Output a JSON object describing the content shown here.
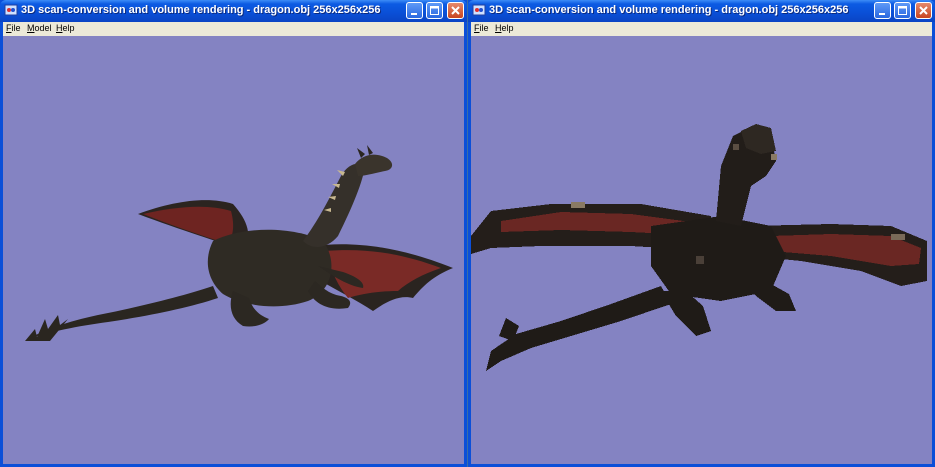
{
  "windows": [
    {
      "id": "left",
      "title": "3D scan-conversion and volume rendering - dragon.obj 256x256x256",
      "menu": [
        {
          "first": "F",
          "rest": "ile"
        },
        {
          "first": "M",
          "rest": "odel"
        },
        {
          "first": "H",
          "rest": "elp"
        }
      ],
      "viewport": "smooth-mesh-dragon"
    },
    {
      "id": "right",
      "title": "3D scan-conversion and volume rendering - dragon.obj 256x256x256",
      "menu": [
        {
          "first": "F",
          "rest": "ile"
        },
        {
          "first": "H",
          "rest": "elp"
        }
      ],
      "viewport": "voxelized-dragon"
    }
  ],
  "icons": {
    "app": "app-icon",
    "minimize": "minimize-icon",
    "maximize": "maximize-icon",
    "close": "close-icon"
  },
  "colors": {
    "titlebar": "#0a4fd6",
    "menubar": "#ece9d8",
    "viewport_bg": "#8483c2",
    "dragon_body": "#2a2620",
    "dragon_wing": "#7a2a26",
    "close_button": "#c8451f"
  }
}
